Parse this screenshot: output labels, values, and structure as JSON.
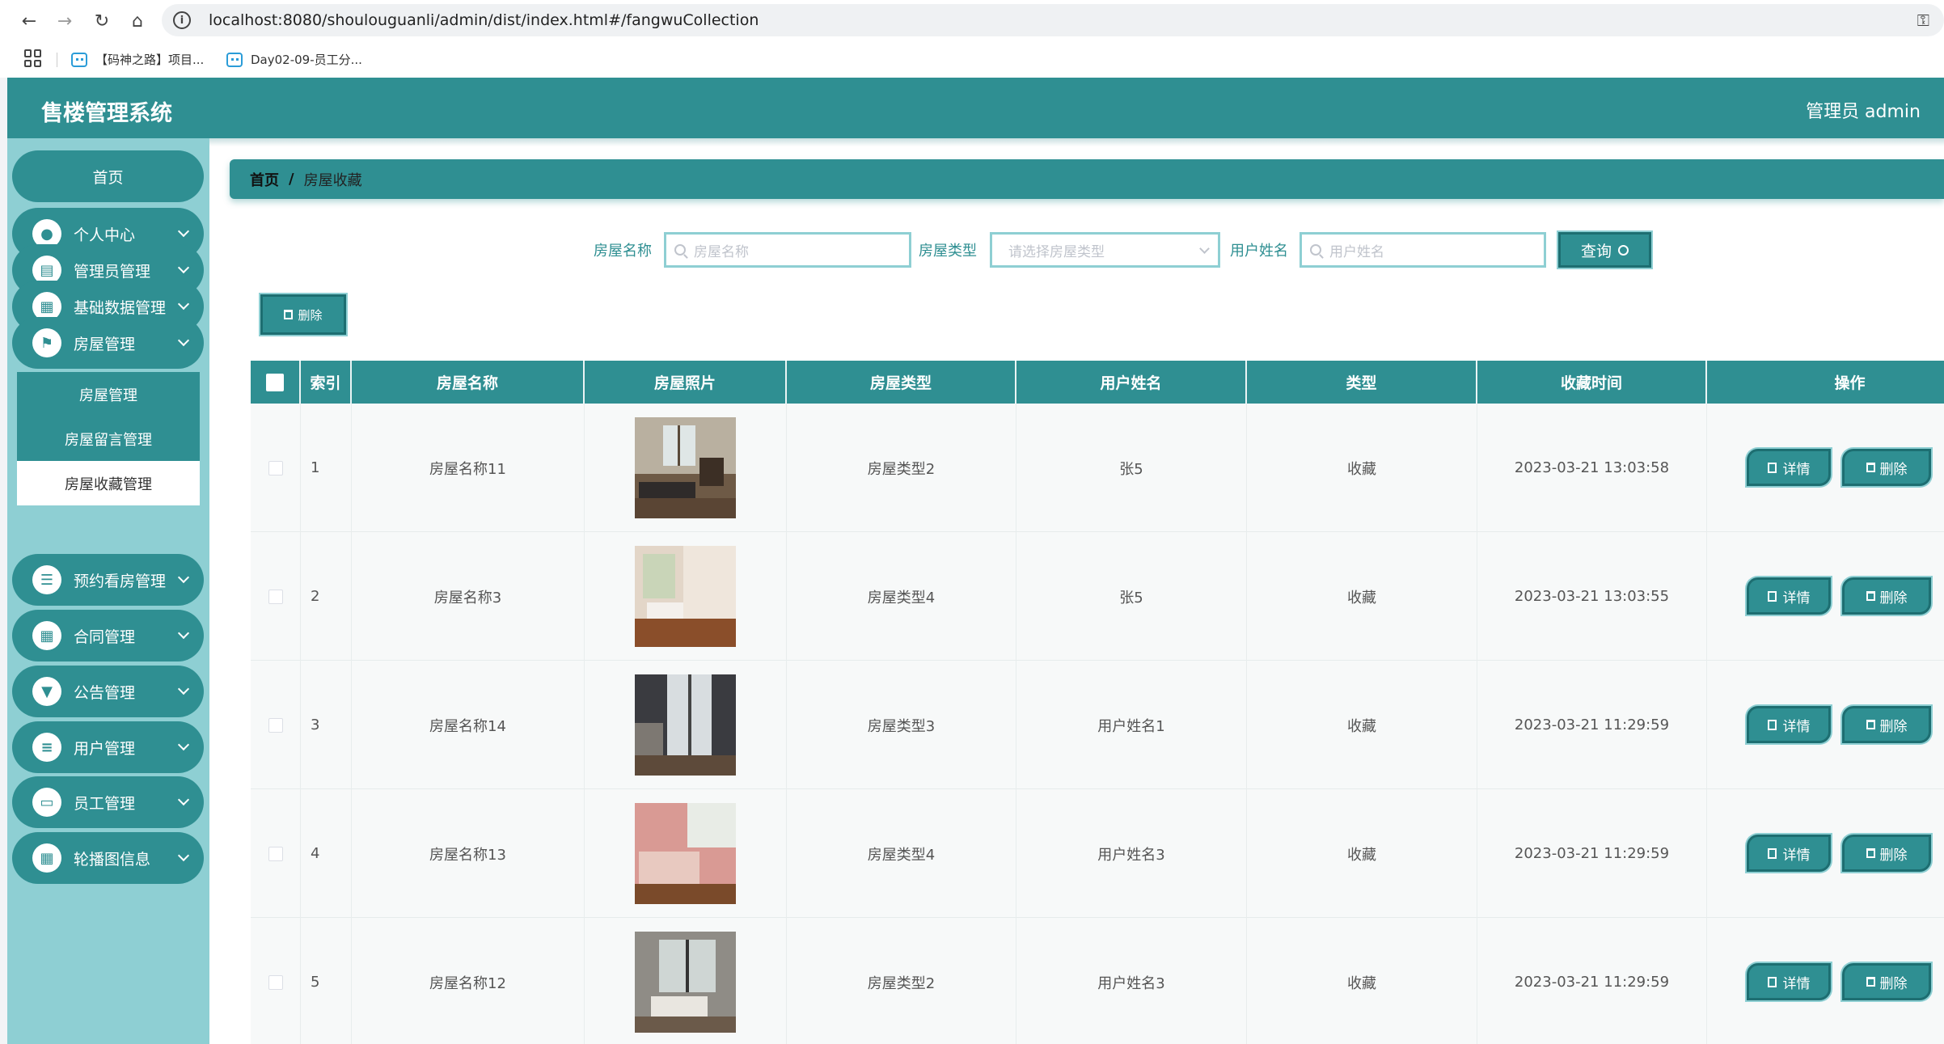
{
  "browser": {
    "url": "localhost:8080/shoulouguanli/admin/dist/index.html#/fangwuCollection",
    "bookmarks": [
      "【码神之路】项目...",
      "Day02-09-员工分..."
    ]
  },
  "header": {
    "title": "售楼管理系统",
    "user": "管理员 admin"
  },
  "sidebar": {
    "home": "首页",
    "items": [
      {
        "label": "个人中心",
        "icon": "user-icon"
      },
      {
        "label": "管理员管理",
        "icon": "clipboard-icon"
      },
      {
        "label": "基础数据管理",
        "icon": "grid-icon"
      },
      {
        "label": "房屋管理",
        "icon": "flag-icon"
      }
    ],
    "submenu": [
      "房屋管理",
      "房屋留言管理",
      "房屋收藏管理"
    ],
    "items_after": [
      {
        "label": "预约看房管理",
        "icon": "sliders-icon"
      },
      {
        "label": "合同管理",
        "icon": "grid-icon"
      },
      {
        "label": "公告管理",
        "icon": "podium-icon"
      },
      {
        "label": "用户管理",
        "icon": "list-icon"
      },
      {
        "label": "员工管理",
        "icon": "monitor-icon"
      },
      {
        "label": "轮播图信息",
        "icon": "grid-icon"
      }
    ]
  },
  "breadcrumb": {
    "home": "首页",
    "separator": "/",
    "current": "房屋收藏"
  },
  "search": {
    "house_name_label": "房屋名称",
    "house_name_placeholder": "房屋名称",
    "house_type_label": "房屋类型",
    "house_type_placeholder": "请选择房屋类型",
    "user_name_label": "用户姓名",
    "user_name_placeholder": "用户姓名",
    "query_button": "查询"
  },
  "toolbar": {
    "delete_button": "删除"
  },
  "table": {
    "headers": [
      "索引",
      "房屋名称",
      "房屋照片",
      "房屋类型",
      "用户姓名",
      "类型",
      "收藏时间",
      "操作"
    ],
    "rows": [
      {
        "index": "1",
        "name": "房屋名称11",
        "type": "房屋类型2",
        "user": "张5",
        "kind": "收藏",
        "time": "2023-03-21 13:03:58"
      },
      {
        "index": "2",
        "name": "房屋名称3",
        "type": "房屋类型4",
        "user": "张5",
        "kind": "收藏",
        "time": "2023-03-21 13:03:55"
      },
      {
        "index": "3",
        "name": "房屋名称14",
        "type": "房屋类型3",
        "user": "用户姓名1",
        "kind": "收藏",
        "time": "2023-03-21 11:29:59"
      },
      {
        "index": "4",
        "name": "房屋名称13",
        "type": "房屋类型4",
        "user": "用户姓名3",
        "kind": "收藏",
        "time": "2023-03-21 11:29:59"
      },
      {
        "index": "5",
        "name": "房屋名称12",
        "type": "房屋类型2",
        "user": "用户姓名3",
        "kind": "收藏",
        "time": "2023-03-21 11:29:59"
      }
    ],
    "detail_button": "详情",
    "delete_button": "删除"
  },
  "colors": {
    "primary": "#2f8f92",
    "sidebar_bg": "#8ecfd3"
  }
}
